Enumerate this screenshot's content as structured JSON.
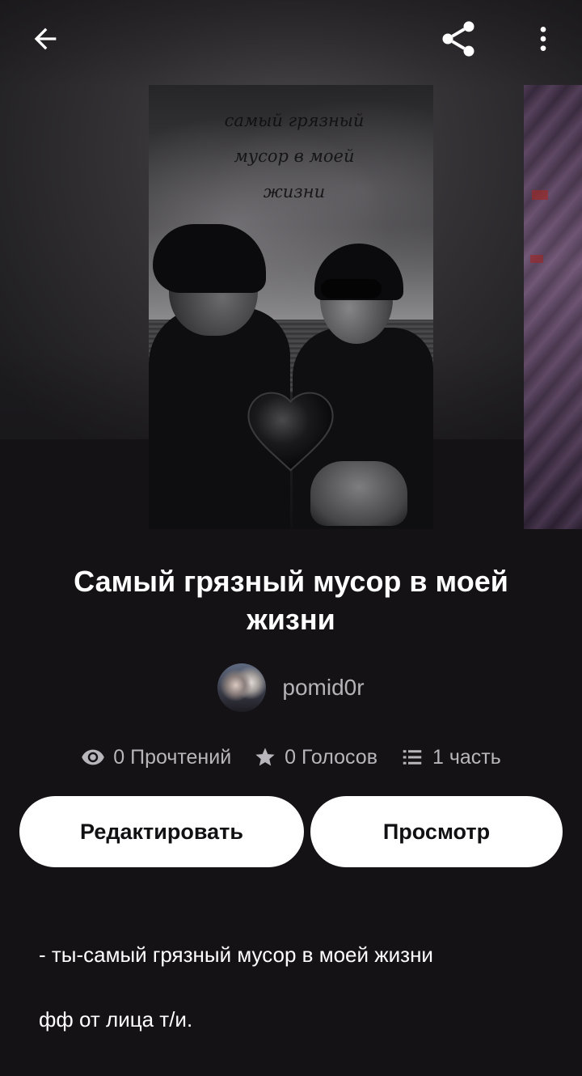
{
  "story": {
    "title": "Самый грязный мусор в моей жизни",
    "cover_text": "самый грязный\nмусор в моей\nжизни",
    "author": "pomid0r",
    "stats": {
      "reads": "0 Прочтений",
      "votes": "0 Голосов",
      "parts": "1 часть"
    },
    "description_lines": [
      "- ты-самый грязный мусор в моей жизни",
      "фф от лица т/и."
    ]
  },
  "actions": {
    "edit_label": "Редактировать",
    "view_label": "Просмотр"
  },
  "icons": {
    "back": "arrow-left-icon",
    "share": "share-icon",
    "more": "more-vertical-icon",
    "reads": "eye-icon",
    "votes": "star-icon",
    "parts": "list-icon"
  },
  "colors": {
    "background": "#141215",
    "button_bg": "#ffffff",
    "secondary_text": "#b8b6ba"
  }
}
